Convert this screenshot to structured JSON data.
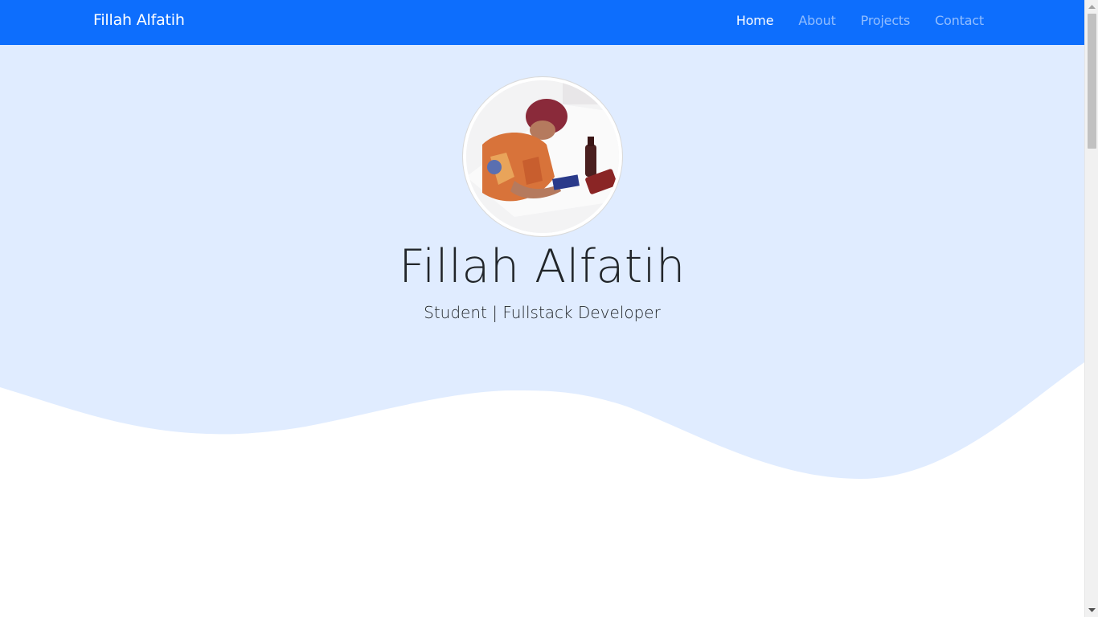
{
  "navbar": {
    "brand": "Fillah Alfatih",
    "items": [
      {
        "label": "Home",
        "active": true
      },
      {
        "label": "About",
        "active": false
      },
      {
        "label": "Projects",
        "active": false
      },
      {
        "label": "Contact",
        "active": false
      }
    ]
  },
  "hero": {
    "name": "Fillah Alfatih",
    "subtitle": "Student | Fullstack Developer",
    "avatar_icon": "profile-photo"
  },
  "colors": {
    "navbar_bg": "#0d6efd",
    "hero_bg": "#e0ecff",
    "text": "#212529"
  }
}
